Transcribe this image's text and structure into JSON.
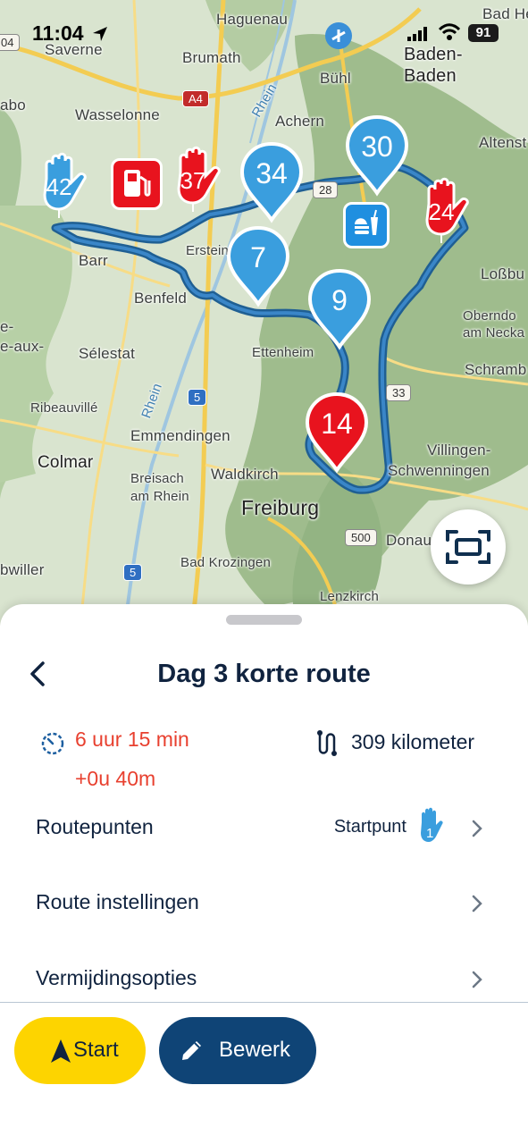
{
  "status_bar": {
    "time": "11:04",
    "battery": "91"
  },
  "map": {
    "places": {
      "haguenau": "Haguenau",
      "saverne": "Saverne",
      "brumath": "Brumath",
      "buhl": "Bühl",
      "baden_baden_1": "Baden-",
      "baden_baden_2": "Baden",
      "bad_he": "Bad He",
      "altenst": "Altenst",
      "wasselonne": "Wasselonne",
      "achern": "Achern",
      "abo": "abo",
      "erstein": "Erstein",
      "barr": "Barr",
      "benfeld": "Benfeld",
      "lossbu": "Loßbu",
      "oberndorf_1": "Oberndo",
      "oberndorf_2": "am Necka",
      "aux": "e-aux-",
      "e_prefix": "e-",
      "selestat": "Sélestat",
      "ettenheim": "Ettenheim",
      "schramb": "Schramb",
      "ribeauville": "Ribeauvillé",
      "emmendingen": "Emmendingen",
      "villingen_1": "Villingen-",
      "villingen_2": "Schwenningen",
      "colmar": "Colmar",
      "waldkirch": "Waldkirch",
      "breisach_1": "Breisach",
      "breisach_2": "am Rhein",
      "freiburg": "Freiburg",
      "donau": "Donau",
      "bwiller": "bwiller",
      "bad_krozingen": "Bad Krozingen",
      "lenzkirch": "Lenzkirch",
      "rhein_1": "Rhein",
      "rhein_2": "Rhein"
    },
    "roads": {
      "a4": "A4",
      "r28": "28",
      "r5a": "5",
      "r5b": "5",
      "r33": "33",
      "r500": "500",
      "r04": "04"
    },
    "markers": {
      "start": "42",
      "fuel_stop": "37",
      "wp_34": "34",
      "wp_30": "30",
      "wp_24": "24",
      "wp_7": "7",
      "wp_9": "9",
      "wp_14": "14"
    },
    "colors": {
      "route": "#2a6fa8",
      "pin_blue": "#3a9ede",
      "pin_red": "#e8131e",
      "accent": "#fdd400",
      "primary": "#0f4476"
    }
  },
  "sheet": {
    "title": "Dag 3 korte route",
    "duration": "6 uur 15 min",
    "duration_delta": "+0u 40m",
    "distance": "309 kilometer",
    "rows": [
      {
        "label": "Routepunten",
        "value": "Startpunt",
        "value_icon": "1"
      },
      {
        "label": "Route instellingen"
      },
      {
        "label": "Vermijdingsopties"
      }
    ],
    "buttons": {
      "start": "Start",
      "edit": "Bewerk"
    }
  }
}
